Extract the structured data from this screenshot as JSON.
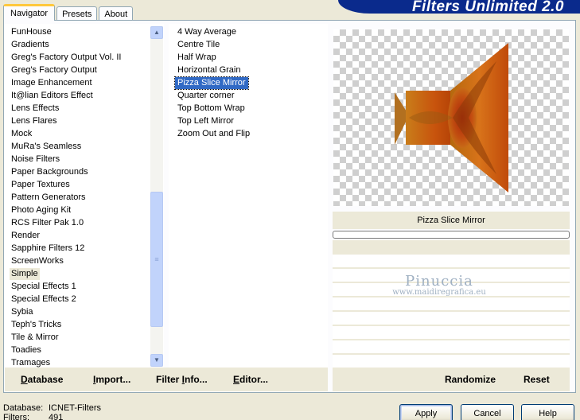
{
  "banner": {
    "title": "Filters Unlimited 2.0"
  },
  "tabs": [
    {
      "label": "Navigator",
      "active": true
    },
    {
      "label": "Presets",
      "active": false
    },
    {
      "label": "About",
      "active": false
    }
  ],
  "categories": [
    "FunHouse",
    "Gradients",
    "Greg's Factory Output Vol. II",
    "Greg's Factory Output",
    "Image Enhancement",
    "It@lian Editors Effect",
    "Lens Effects",
    "Lens Flares",
    "Mock",
    "MuRa's Seamless",
    "Noise Filters",
    "Paper Backgrounds",
    "Paper Textures",
    "Pattern Generators",
    "Photo Aging Kit",
    "RCS Filter Pak 1.0",
    "Render",
    "Sapphire Filters 12",
    "ScreenWorks",
    "Simple",
    "Special Effects 1",
    "Special Effects 2",
    "Sybia",
    "Teph's Tricks",
    "Tile & Mirror",
    "Toadies",
    "Tramages"
  ],
  "selected_category": "Simple",
  "filters": [
    "4 Way Average",
    "Centre Tile",
    "Half Wrap",
    "Horizontal Grain",
    "Pizza Slice Mirror",
    "Quarter corner",
    "Top Bottom Wrap",
    "Top Left Mirror",
    "Zoom Out and Flip"
  ],
  "selected_filter": "Pizza Slice Mirror",
  "preview": {
    "filter_name": "Pizza Slice Mirror",
    "progress": 0
  },
  "watermark": {
    "name": "Pinuccia",
    "site": "www.maidiregrafica.eu"
  },
  "left_toolbar": {
    "database": {
      "label": "Database",
      "key": "D",
      "rest": "atabase"
    },
    "import": {
      "label": "Import...",
      "key": "I",
      "rest": "mport..."
    },
    "filter_info": {
      "label": "Filter Info...",
      "key": "I",
      "prefix": "Filter ",
      "rest": "nfo..."
    },
    "editor": {
      "label": "Editor...",
      "key": "E",
      "rest": "ditor..."
    }
  },
  "right_toolbar": {
    "randomize": "Randomize",
    "reset": "Reset"
  },
  "status": {
    "database_label": "Database:",
    "database_value": "ICNET-Filters",
    "filters_label": "Filters:",
    "filters_value": "491"
  },
  "buttons": {
    "apply": "Apply",
    "cancel": "Cancel",
    "help": "Help"
  },
  "colors": {
    "selection": "#316ac5",
    "banner": "#0a2a8c",
    "tab_highlight": "#ffc83c"
  },
  "icons": {
    "scroll_up": "scroll-up-arrow-icon",
    "scroll_down": "scroll-down-arrow-icon",
    "thumb_grip": "grip-icon"
  }
}
